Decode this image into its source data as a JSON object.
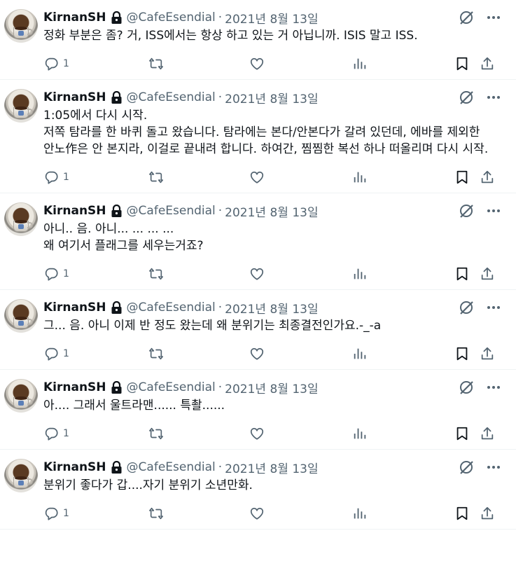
{
  "colors": {
    "text": "#0f1419",
    "secondary": "#536471",
    "border": "#eff3f4"
  },
  "tweets": [
    {
      "name": "KirnanSH",
      "handle": "@CafeEsendial",
      "separator": "·",
      "date": "2021년 8월 13일",
      "text": "정화 부분은 좀? 거, ISS에서는 항상 하고 있는 거 아닙니까. ISIS 말고 ISS.",
      "reply_count": "1"
    },
    {
      "name": "KirnanSH",
      "handle": "@CafeEsendial",
      "separator": "·",
      "date": "2021년 8월 13일",
      "text": "1:05에서 다시 시작.\n저쪽 탐라를 한 바퀴 돌고 왔습니다. 탐라에는 본다/안본다가 갈려 있던데, 에바를 제외한 안노作은 안 본지라, 이걸로 끝내려 합니다. 하여간, 찜찜한 복선 하나 떠올리며 다시 시작.",
      "reply_count": "1"
    },
    {
      "name": "KirnanSH",
      "handle": "@CafeEsendial",
      "separator": "·",
      "date": "2021년 8월 13일",
      "text": "아니.. 음. 아니... ... ... ...\n왜 여기서 플래그를 세우는거죠?",
      "reply_count": "1"
    },
    {
      "name": "KirnanSH",
      "handle": "@CafeEsendial",
      "separator": "·",
      "date": "2021년 8월 13일",
      "text": "그... 음. 아니 이제 반 정도 왔는데 왜 분위기는 최종결전인가요.-_-a",
      "reply_count": "1"
    },
    {
      "name": "KirnanSH",
      "handle": "@CafeEsendial",
      "separator": "·",
      "date": "2021년 8월 13일",
      "text": "아.... 그래서 울트라맨...... 특촬......",
      "reply_count": "1"
    },
    {
      "name": "KirnanSH",
      "handle": "@CafeEsendial",
      "separator": "·",
      "date": "2021년 8월 13일",
      "text": "분위기 좋다가 갑....자기 분위기 소년만화.",
      "reply_count": "1"
    }
  ],
  "icons": {
    "lock": "lock-icon",
    "grok": "grok-icon",
    "more": "more-icon",
    "reply": "reply-icon",
    "retweet": "retweet-icon",
    "like": "like-icon",
    "views": "views-icon",
    "bookmark": "bookmark-icon",
    "share": "share-icon"
  }
}
